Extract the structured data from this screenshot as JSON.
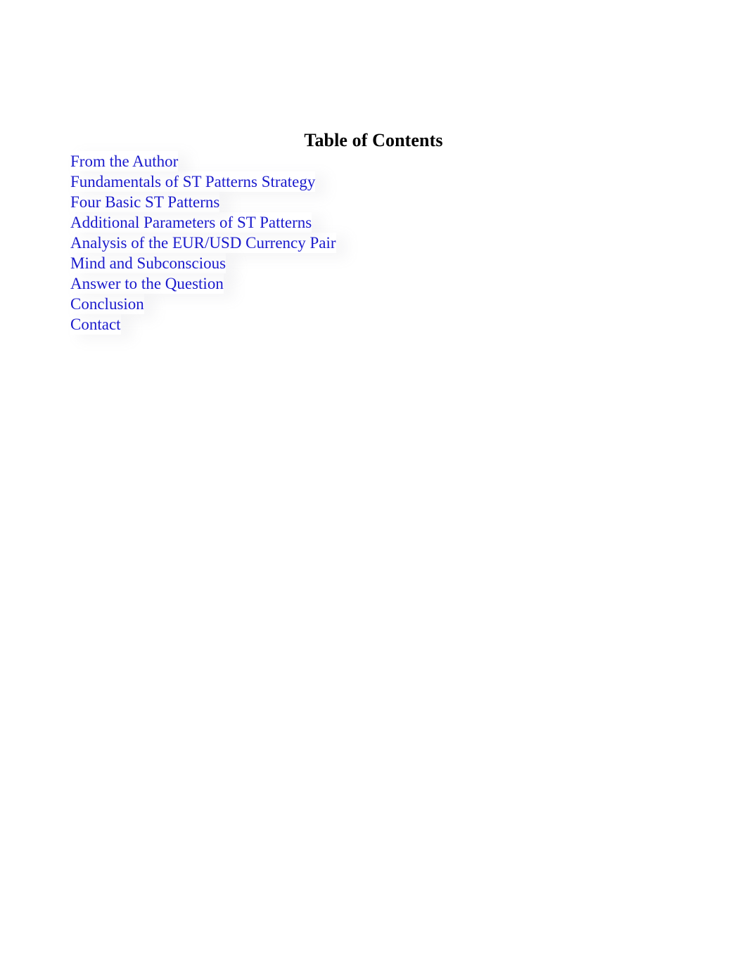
{
  "document": {
    "title": "Table of Contents",
    "background_color": "#ffffff",
    "title_color": "#000000",
    "link_color": "#1a1acc"
  },
  "toc": {
    "heading": "Table of Contents",
    "entries": [
      {
        "label": "From the Author"
      },
      {
        "label": "Fundamentals of ST Patterns Strategy"
      },
      {
        "label": "Four Basic ST Patterns"
      },
      {
        "label": "Additional Parameters of ST Patterns"
      },
      {
        "label": "Analysis of the EUR/USD Currency Pair"
      },
      {
        "label": "Mind and Subconscious"
      },
      {
        "label": "Answer to the Question"
      },
      {
        "label": "Conclusion"
      },
      {
        "label": "Contact"
      }
    ]
  }
}
